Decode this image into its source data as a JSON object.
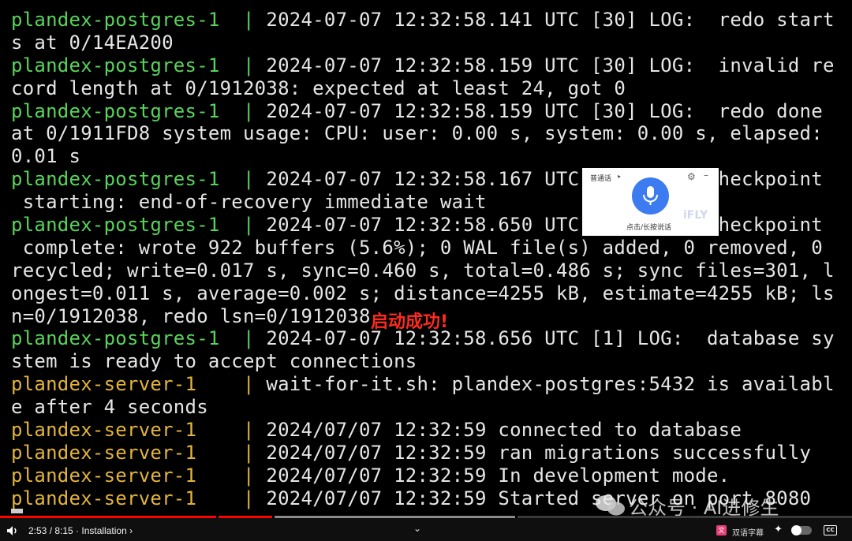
{
  "terminal": {
    "lines": [
      {
        "prefix": "plandex-postgres-1  | ",
        "text": "2024-07-07 12:32:58.141 UTC [30] LOG:  redo start",
        "kind": "pg"
      },
      {
        "prefix": "",
        "text": "s at 0/14EA200",
        "kind": "plain"
      },
      {
        "prefix": "plandex-postgres-1  | ",
        "text": "2024-07-07 12:32:58.159 UTC [30] LOG:  invalid re",
        "kind": "pg"
      },
      {
        "prefix": "",
        "text": "cord length at 0/1912038: expected at least 24, got 0",
        "kind": "plain"
      },
      {
        "prefix": "plandex-postgres-1  | ",
        "text": "2024-07-07 12:32:58.159 UTC [30] LOG:  redo done",
        "kind": "pg"
      },
      {
        "prefix": "",
        "text": "at 0/1911FD8 system usage: CPU: user: 0.00 s, system: 0.00 s, elapsed:",
        "kind": "plain"
      },
      {
        "prefix": "",
        "text": "0.01 s",
        "kind": "plain"
      },
      {
        "prefix": "plandex-postgres-1  | ",
        "text": "2024-07-07 12:32:58.167 UTC [1] LOG:  checkpoint",
        "kind": "pg"
      },
      {
        "prefix": "",
        "text": " starting: end-of-recovery immediate wait",
        "kind": "plain"
      },
      {
        "prefix": "plandex-postgres-1  | ",
        "text": "2024-07-07 12:32:58.650 UTC [1] LOG:  checkpoint",
        "kind": "pg"
      },
      {
        "prefix": "",
        "text": " complete: wrote 922 buffers (5.6%); 0 WAL file(s) added, 0 removed, 0",
        "kind": "plain"
      },
      {
        "prefix": "",
        "text": "recycled; write=0.017 s, sync=0.460 s, total=0.486 s; sync files=301, l",
        "kind": "plain"
      },
      {
        "prefix": "",
        "text": "ongest=0.011 s, average=0.002 s; distance=4255 kB, estimate=4255 kB; ls",
        "kind": "plain"
      },
      {
        "prefix": "",
        "text": "n=0/1912038, redo lsn=0/1912038",
        "kind": "plain"
      },
      {
        "prefix": "plandex-postgres-1  | ",
        "text": "2024-07-07 12:32:58.656 UTC [1] LOG:  database sy",
        "kind": "pg"
      },
      {
        "prefix": "",
        "text": "stem is ready to accept connections",
        "kind": "plain"
      },
      {
        "prefix": "plandex-server-1    | ",
        "text": "wait-for-it.sh: plandex-postgres:5432 is availabl",
        "kind": "sv"
      },
      {
        "prefix": "",
        "text": "e after 4 seconds",
        "kind": "plain"
      },
      {
        "prefix": "plandex-server-1    | ",
        "text": "2024/07/07 12:32:59 connected to database",
        "kind": "sv"
      },
      {
        "prefix": "plandex-server-1    | ",
        "text": "2024/07/07 12:32:59 ran migrations successfully",
        "kind": "sv"
      },
      {
        "prefix": "plandex-server-1    | ",
        "text": "2024/07/07 12:32:59 In development mode.",
        "kind": "sv"
      },
      {
        "prefix": "plandex-server-1    | ",
        "text": "2024/07/07 12:32:59 Started server on port 8080",
        "kind": "sv"
      }
    ]
  },
  "overlay": {
    "success_text": "启动成功!"
  },
  "voice_widget": {
    "language": "普通话",
    "hint": "点击/长按说话",
    "brand": "iFLY",
    "mic_color": "#3d7cf0"
  },
  "watermark": {
    "text": "公众号 · AI进修生"
  },
  "player": {
    "time": "2:53 / 8:15 · Installation ›",
    "played_fraction": 0.321,
    "buffered_fraction": 0.605,
    "subtitle_badge": "文",
    "subtitle_label": "双语字幕",
    "cc_label": "CC",
    "progress_color": "#ff0000"
  },
  "colors": {
    "postgres": "#58d35b",
    "server": "#e3b43a",
    "text": "#e6e6e6"
  }
}
